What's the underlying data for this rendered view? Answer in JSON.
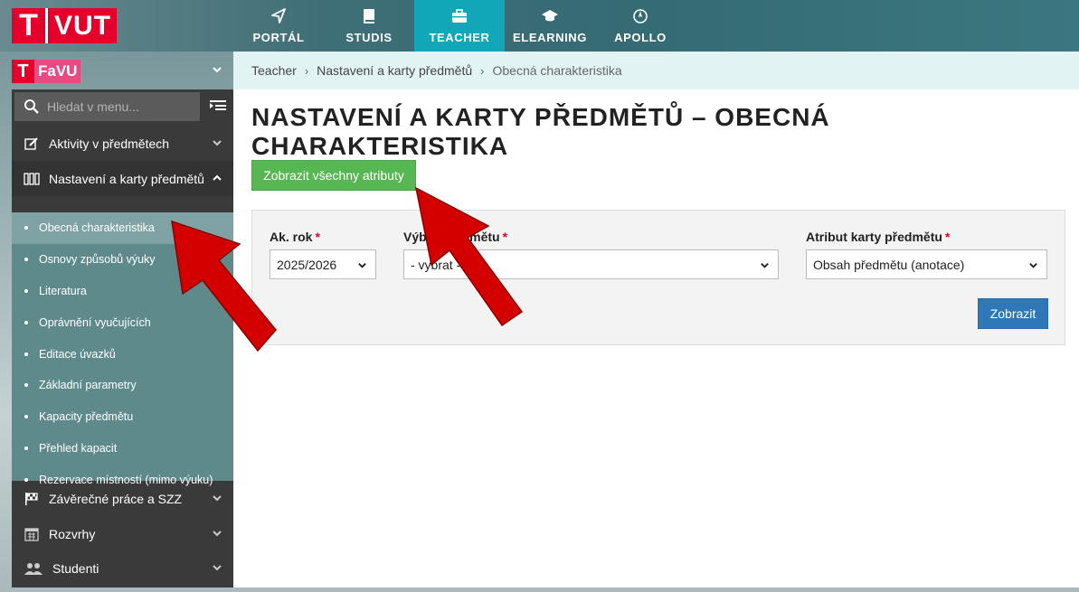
{
  "header": {
    "logo_text": "VUT",
    "logo_letter": "T",
    "nav": [
      {
        "label": "PORTÁL",
        "icon": "navigation-arrow-icon",
        "active": false
      },
      {
        "label": "STUDIS",
        "icon": "book-icon",
        "active": false
      },
      {
        "label": "TEACHER",
        "icon": "briefcase-icon",
        "active": true
      },
      {
        "label": "ELEARNING",
        "icon": "graduation-cap-icon",
        "active": false
      },
      {
        "label": "APOLLO",
        "icon": "rocket-icon",
        "active": false
      }
    ]
  },
  "sidebar": {
    "faculty": "FaVU",
    "faculty_letter": "T",
    "search_placeholder": "Hledat v menu...",
    "groups": [
      {
        "label": "Aktivity v předmětech",
        "icon": "edit-icon",
        "expanded": false
      },
      {
        "label": "Nastavení a karty předmětů",
        "icon": "binders-icon",
        "expanded": true
      },
      {
        "label": "Závěrečné práce a SZZ",
        "icon": "flag-icon",
        "expanded": false
      },
      {
        "label": "Rozvrhy",
        "icon": "calendar-icon",
        "expanded": false
      },
      {
        "label": "Studenti",
        "icon": "users-icon",
        "expanded": false
      }
    ],
    "submenu": [
      {
        "label": "Obecná charakteristika",
        "active": true
      },
      {
        "label": "Osnovy způsobů výuky",
        "active": false
      },
      {
        "label": "Literatura",
        "active": false
      },
      {
        "label": "Oprávnění vyučujících",
        "active": false
      },
      {
        "label": "Editace úvazků",
        "active": false
      },
      {
        "label": "Základní parametry",
        "active": false
      },
      {
        "label": "Kapacity předmětu",
        "active": false
      },
      {
        "label": "Přehled kapacit",
        "active": false
      },
      {
        "label": "Rezervace místností (mimo výuku)",
        "active": false
      }
    ]
  },
  "breadcrumb": [
    "Teacher",
    "Nastavení a karty předmětů",
    "Obecná charakteristika"
  ],
  "main": {
    "title": "NASTAVENÍ A KARTY PŘEDMĚTŮ – OBECNÁ CHARAKTERISTIKA",
    "show_all_button": "Zobrazit všechny atributy",
    "form": {
      "year_label": "Ak. rok",
      "year_value": "2025/2026",
      "course_label": "Výběr předmětu",
      "course_value": "- vybrat -",
      "attribute_label": "Atribut karty předmětu",
      "attribute_value": "Obsah předmětu (anotace)",
      "required_mark": "*",
      "submit_label": "Zobrazit"
    }
  },
  "colors": {
    "accent_red": "#e4002b",
    "active_tab": "#12a7b8",
    "green_button": "#56b753",
    "blue_button": "#2f78b7",
    "annotation_arrow": "#d40000"
  }
}
